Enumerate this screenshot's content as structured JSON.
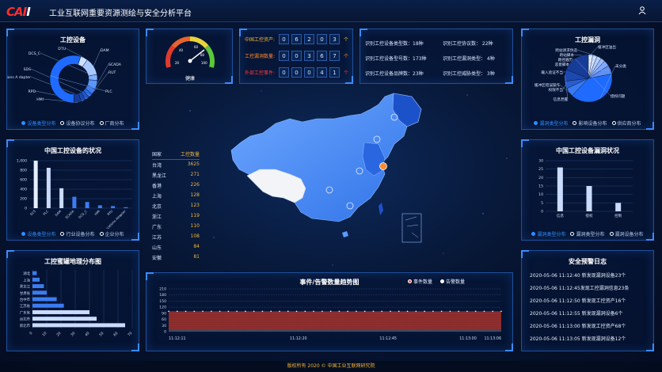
{
  "header": {
    "logo_main": "CAI",
    "logo_suffix": "I",
    "title": "工业互联网重要资源测绘与安全分析平台",
    "user_icon": "user-icon"
  },
  "p_devices": {
    "title": "工控设备",
    "legend": [
      "设备类型分布",
      "设备协议分布",
      "厂商分布"
    ],
    "donut_labels": [
      "DTU",
      "DAM",
      "DCS_C",
      "SCADA",
      "RUT",
      "SDS",
      "Communic ations A dapter",
      "RPD",
      "HMI",
      "PLC"
    ]
  },
  "gauge": {
    "label": "健康",
    "ticks": [
      "0",
      "20",
      "40",
      "60",
      "80",
      "100"
    ],
    "value": 75
  },
  "counters": [
    {
      "label": "中国工控资产:",
      "digits": [
        "0",
        "6",
        "2",
        "0",
        "3"
      ],
      "unit": "个",
      "color": "#f0b43c"
    },
    {
      "label": "工控漏洞数量:",
      "digits": [
        "0",
        "0",
        "3",
        "6",
        "7"
      ],
      "unit": "个",
      "color": "#ff8a2a"
    },
    {
      "label": "外部工控事件:",
      "digits": [
        "0",
        "0",
        "0",
        "4",
        "1"
      ],
      "unit": "个",
      "color": "#ff3a3a"
    }
  ],
  "stats": {
    "left": [
      "识别工控设备类型数：18种",
      "识别工控设备型号数：173种",
      "识别工控设备品牌数：23种"
    ],
    "right": [
      "识别工控协议数： 22种",
      "识别工控漏洞类型： 4种",
      "识别工控威胁类型： 3种"
    ]
  },
  "p_vuln": {
    "title": "工控漏洞",
    "legend": [
      "漏洞类型分布",
      "影响设备分布",
      "供应商分布"
    ],
    "pie_labels": [
      "缓冲区溢出",
      "跨站请求伪造",
      "跨站脚本",
      "路径遍历",
      "恶意脚本",
      "输入验证不当",
      "未分类",
      "缓冲区错误操作",
      "权限不当",
      "信息泄露",
      "授权问题"
    ]
  },
  "p_cn_status": {
    "title": "中国工控设备的状况",
    "legend": [
      "设备类型分布",
      "行业设备分布",
      "企业分布"
    ],
    "yticks": [
      "1,000",
      "800",
      "600",
      "400",
      "200",
      "0"
    ]
  },
  "province_table": {
    "header": [
      "国家",
      "工控数量"
    ],
    "rows": [
      [
        "台湾",
        "3625"
      ],
      [
        "黑龙江",
        "271"
      ],
      [
        "香港",
        "226"
      ],
      [
        "上海",
        "128"
      ],
      [
        "北京",
        "123"
      ],
      [
        "浙江",
        "119"
      ],
      [
        "广东",
        "110"
      ],
      [
        "江苏",
        "108"
      ],
      [
        "山东",
        "84"
      ],
      [
        "安徽",
        "81"
      ]
    ]
  },
  "p_cn_vuln": {
    "title": "中国工控设备漏洞状况",
    "legend": [
      "漏洞类型分布",
      "漏洞类型分布",
      "漏洞设备分布"
    ],
    "yticks": [
      "30",
      "25",
      "20",
      "15",
      "10",
      "5",
      "0"
    ]
  },
  "p_geo": {
    "title": "工控蜜罐地理分布图",
    "xticks": [
      "0",
      "10",
      "20",
      "30",
      "40",
      "50",
      "60",
      "70"
    ]
  },
  "p_trend": {
    "title": "事件/告警数量趋势图",
    "legend": [
      "事件数量",
      "告警数量"
    ],
    "yticks": [
      "210",
      "180",
      "150",
      "120",
      "90",
      "60",
      "30",
      "0"
    ],
    "xticks": [
      "11:12:11",
      "11:12:20",
      "11:12:45",
      "11:13:00",
      "11:13:06"
    ]
  },
  "p_log": {
    "title": "安全预警日志",
    "items": [
      "2020-05-06 11:12:40 新发现漏洞设备23个",
      "2020-05-06 11:12:45发现工控漏洞信息23条",
      "2020-05-06 11:12:50 新发现工控资产16个",
      "2020-05-06 11:12:55 新发现漏洞设备6个",
      "2020-05-06 11:13:00 新发现工控资产68个",
      "2020-05-06 11:13:05 新发现漏洞设备12个"
    ]
  },
  "footer": {
    "text": "版权所有  2020 © 中国工业互联网研究院"
  },
  "colors": {
    "accent": "#2f8dff",
    "gold": "#f0b43c",
    "red": "#ff3a3a",
    "panel_border": "#1f4f9a"
  },
  "chart_data": [
    {
      "type": "bar",
      "title": "中国工控设备的状况",
      "categories": [
        "SCS",
        "PLC",
        "DAM",
        "SCADA",
        "DCS_C",
        "HMI",
        "RTU",
        "Communications Adapter"
      ],
      "values": [
        1000,
        850,
        420,
        240,
        130,
        60,
        45,
        20
      ],
      "ylim": [
        0,
        1000
      ]
    },
    {
      "type": "bar",
      "title": "中国工控设备漏洞状况",
      "categories": [
        "信息",
        "授权",
        "控制"
      ],
      "values": [
        26,
        15,
        5
      ],
      "ylim": [
        0,
        30
      ]
    },
    {
      "type": "bar",
      "title": "工控蜜罐地理分布图",
      "orientation": "horizontal",
      "categories": [
        "湖北",
        "上海",
        "黑龙江",
        "甘肃省",
        "台中市",
        "江苏省",
        "广东省",
        "台北市",
        "新北市"
      ],
      "values": [
        3,
        5,
        8,
        10,
        17,
        22,
        40,
        45,
        65
      ],
      "xlim": [
        0,
        70
      ]
    },
    {
      "type": "area",
      "title": "事件/告警数量趋势图",
      "series": [
        {
          "name": "事件数量",
          "values": [
            100,
            100,
            100,
            100,
            100,
            100,
            100,
            100,
            100,
            100,
            100,
            100,
            100,
            100,
            100,
            100,
            100,
            100,
            100,
            100,
            100,
            100,
            100,
            100,
            100,
            100,
            100,
            100,
            100,
            100,
            100,
            100,
            100,
            100,
            100,
            100,
            100,
            100,
            100,
            100
          ]
        },
        {
          "name": "告警数量",
          "values": [
            10,
            10,
            10,
            10,
            10,
            10,
            10,
            10,
            10,
            10,
            10,
            10,
            10,
            10,
            10,
            10,
            10,
            10,
            10,
            10,
            10,
            10,
            10,
            10,
            10,
            10,
            10,
            10,
            10,
            10,
            10,
            10,
            10,
            10,
            10,
            10,
            10,
            10,
            10,
            10
          ]
        }
      ],
      "ylim": [
        0,
        210
      ]
    },
    {
      "type": "pie",
      "title": "工控设备",
      "labels": [
        "DTU",
        "DAM",
        "DCS_C",
        "SCADA",
        "RUT",
        "SDS",
        "Communic ations A dapter",
        "RPD",
        "HMI",
        "PLC"
      ],
      "values": [
        5,
        12,
        4,
        6,
        4,
        3,
        3,
        3,
        5,
        55
      ]
    },
    {
      "type": "pie",
      "title": "工控漏洞",
      "labels": [
        "缓冲区溢出",
        "跨站请求伪造",
        "跨站脚本",
        "路径遍历",
        "恶意脚本",
        "输入验证不当",
        "未分类",
        "缓冲区错误操作",
        "权限不当",
        "信息泄露",
        "授权问题"
      ],
      "values": [
        3,
        3,
        3,
        3,
        4,
        6,
        40,
        6,
        5,
        8,
        19
      ]
    }
  ]
}
